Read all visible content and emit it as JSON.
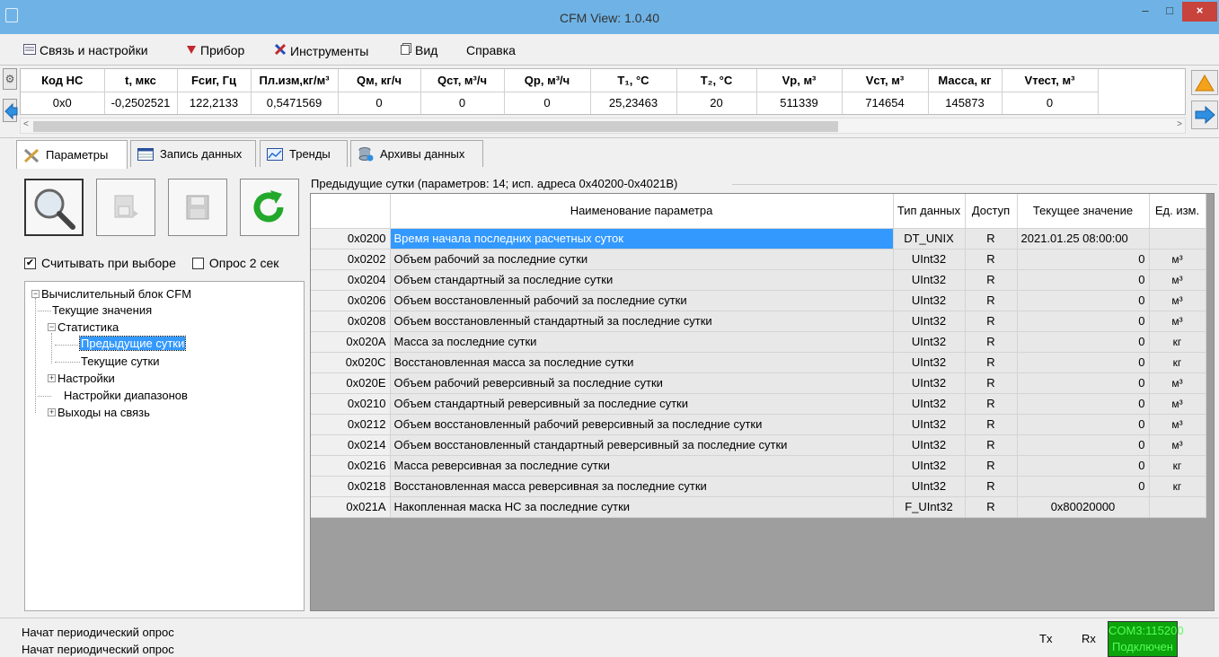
{
  "window": {
    "title": "CFM View: 1.0.40",
    "min": "–",
    "max": "□",
    "close": "×"
  },
  "menu": [
    {
      "label": "Связь и настройки",
      "icon": "connection-settings-icon"
    },
    {
      "label": "Прибор",
      "icon": "device-icon"
    },
    {
      "label": "Инструменты",
      "icon": "tools-icon"
    },
    {
      "label": "Вид",
      "icon": "view-icon"
    },
    {
      "label": "Справка",
      "icon": ""
    }
  ],
  "top_grid": {
    "headers": [
      "Код НС",
      "t, мкс",
      "Fсиг, Гц",
      "Пл.изм,кг/м³",
      "Qм, кг/ч",
      "Qст, м³/ч",
      "Qр, м³/ч",
      "T₁, °C",
      "T₂, °C",
      "Vр, м³",
      "Vст, м³",
      "Масса, кг",
      "Vтест, м³"
    ],
    "values": [
      "0x0",
      "-0,2502521",
      "122,2133",
      "0,5471569",
      "0",
      "0",
      "0",
      "25,23463",
      "20",
      "511339",
      "714654",
      "145873",
      "0"
    ]
  },
  "tabs": [
    {
      "label": "Параметры",
      "icon": "tools-icon",
      "active": true
    },
    {
      "label": "Запись данных",
      "icon": "table-icon",
      "active": false
    },
    {
      "label": "Тренды",
      "icon": "chart-icon",
      "active": false
    },
    {
      "label": "Архивы данных",
      "icon": "database-icon",
      "active": false
    }
  ],
  "toolbar": {
    "search": "search-icon",
    "import": "import-file-icon",
    "save": "save-icon",
    "refresh": "refresh-icon"
  },
  "options": {
    "read_on_select": {
      "label": "Считывать при выборе",
      "checked": true
    },
    "poll_2s": {
      "label": "Опрос 2 сек",
      "checked": false
    }
  },
  "tree": {
    "root": "Вычислительный блок CFM",
    "current_values": "Текущие значения",
    "statistics": "Статистика",
    "prev_day": "Предыдущие сутки",
    "current_day": "Текущие сутки",
    "settings": "Настройки",
    "range_settings": "Настройки диапазонов",
    "outputs": "Выходы на связь"
  },
  "group_title": "Предыдущие сутки (параметров: 14; исп. адреса 0x40200-0x4021B)",
  "param_grid": {
    "headers": {
      "name": "Наименование параметра",
      "type": "Тип данных",
      "access": "Доступ",
      "value": "Текущее значение",
      "unit": "Ед. изм."
    },
    "rows": [
      {
        "addr": "0x0200",
        "name": "Время начала последних расчетных суток",
        "type": "DT_UNIX",
        "access": "R",
        "value": "2021.01.25 08:00:00",
        "unit": ""
      },
      {
        "addr": "0x0202",
        "name": "Объем рабочий за последние сутки",
        "type": "UInt32",
        "access": "R",
        "value": "0",
        "unit": "м³"
      },
      {
        "addr": "0x0204",
        "name": "Объем стандартный за последние сутки",
        "type": "UInt32",
        "access": "R",
        "value": "0",
        "unit": "м³"
      },
      {
        "addr": "0x0206",
        "name": "Объем восстановленный рабочий за последние сутки",
        "type": "UInt32",
        "access": "R",
        "value": "0",
        "unit": "м³"
      },
      {
        "addr": "0x0208",
        "name": "Объем восстановленный стандартный за последние сутки",
        "type": "UInt32",
        "access": "R",
        "value": "0",
        "unit": "м³"
      },
      {
        "addr": "0x020A",
        "name": "Масса за последние сутки",
        "type": "UInt32",
        "access": "R",
        "value": "0",
        "unit": "кг"
      },
      {
        "addr": "0x020C",
        "name": "Восстановленная масса за последние сутки",
        "type": "UInt32",
        "access": "R",
        "value": "0",
        "unit": "кг"
      },
      {
        "addr": "0x020E",
        "name": "Объем рабочий реверсивный за последние сутки",
        "type": "UInt32",
        "access": "R",
        "value": "0",
        "unit": "м³"
      },
      {
        "addr": "0x0210",
        "name": "Объем стандартный реверсивный за последние сутки",
        "type": "UInt32",
        "access": "R",
        "value": "0",
        "unit": "м³"
      },
      {
        "addr": "0x0212",
        "name": "Объем восстановленный рабочий реверсивный за последние сутки",
        "type": "UInt32",
        "access": "R",
        "value": "0",
        "unit": "м³"
      },
      {
        "addr": "0x0214",
        "name": "Объем восстановленный стандартный реверсивный за последние сутки",
        "type": "UInt32",
        "access": "R",
        "value": "0",
        "unit": "м³"
      },
      {
        "addr": "0x0216",
        "name": "Масса реверсивная за последние сутки",
        "type": "UInt32",
        "access": "R",
        "value": "0",
        "unit": "кг"
      },
      {
        "addr": "0x0218",
        "name": "Восстановленная масса реверсивная за последние сутки",
        "type": "UInt32",
        "access": "R",
        "value": "0",
        "unit": "кг"
      },
      {
        "addr": "0x021A",
        "name": "Накопленная маска НС за последние сутки",
        "type": "F_UInt32",
        "access": "R",
        "value": "0x80020000",
        "unit": ""
      }
    ]
  },
  "status": {
    "line1": "Начат периодический опрос",
    "line2": "Начат периодический опрос",
    "tx": "Tx",
    "rx": "Rx",
    "port": "COM3:115200",
    "state": "Подключен"
  },
  "colors": {
    "titlebar": "#6fb3e6",
    "selection": "#3399ff",
    "connected_bg": "#0ca30c",
    "connected_text": "#55ff55",
    "close_btn": "#c7433b"
  }
}
